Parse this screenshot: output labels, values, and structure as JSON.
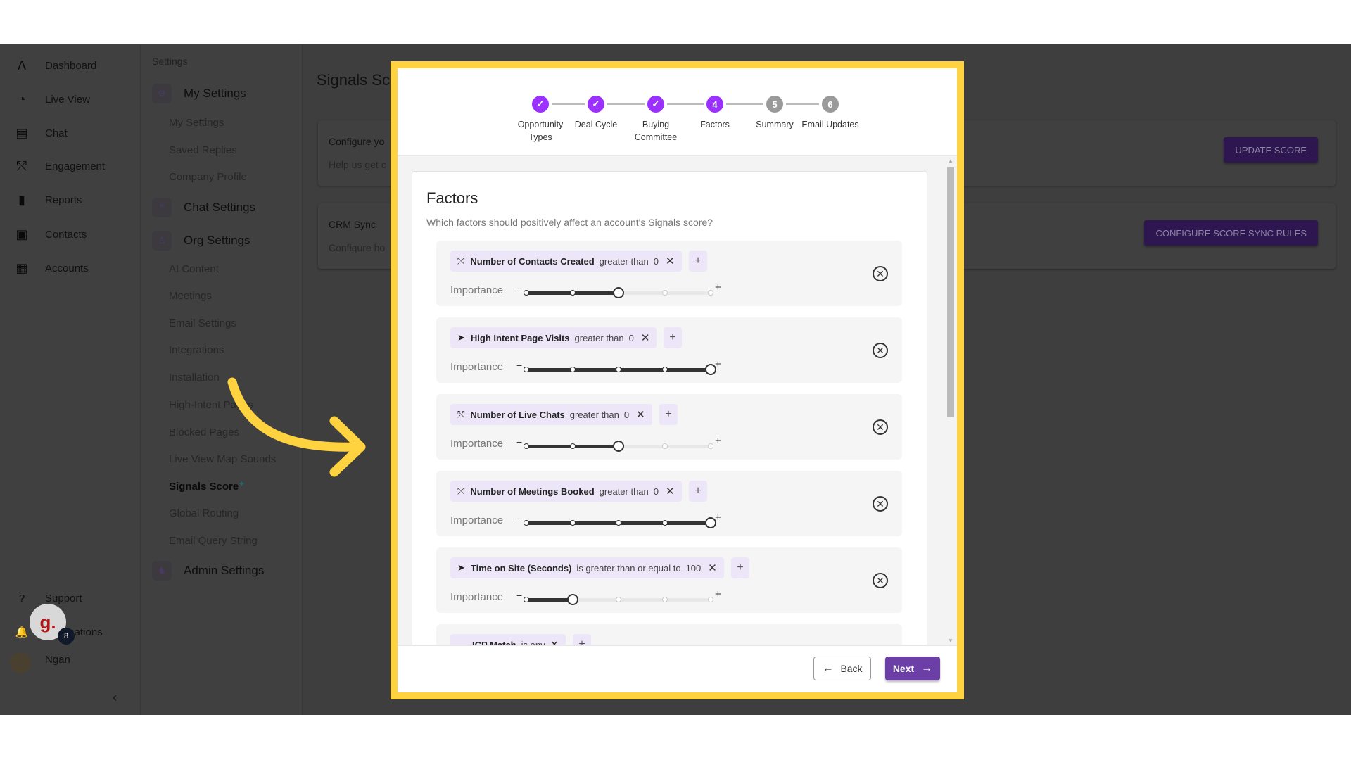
{
  "nav": {
    "items": [
      {
        "label": "Dashboard",
        "icon": "logo-icon"
      },
      {
        "label": "Live View",
        "icon": "live-view-icon"
      },
      {
        "label": "Chat",
        "icon": "chat-icon"
      },
      {
        "label": "Engagement",
        "icon": "engagement-icon"
      },
      {
        "label": "Reports",
        "icon": "reports-icon"
      },
      {
        "label": "Contacts",
        "icon": "contacts-icon"
      },
      {
        "label": "Accounts",
        "icon": "accounts-icon"
      }
    ],
    "support": "Support",
    "notifications": "Notifications",
    "user": "Ngan",
    "chat_bubble": "g.",
    "chat_badge": "8"
  },
  "settings": {
    "title": "Settings",
    "my_settings": "My Settings",
    "my_items": [
      "My Settings",
      "Saved Replies",
      "Company Profile"
    ],
    "chat_settings": "Chat Settings",
    "org_settings": "Org Settings",
    "org_items": [
      "AI Content",
      "Meetings",
      "Email Settings",
      "Integrations",
      "Installation",
      "High-Intent Pages",
      "Blocked Pages",
      "Live View Map Sounds",
      "Signals Score",
      "Global Routing",
      "Email Query String"
    ],
    "active": "Signals Score",
    "admin_settings": "Admin Settings"
  },
  "main": {
    "title": "Signals Sc",
    "cards": [
      {
        "title": "Configure yo",
        "desc": "Help us get c",
        "button": "UPDATE SCORE"
      },
      {
        "title": "CRM Sync",
        "desc": "Configure ho",
        "button": "CONFIGURE SCORE SYNC RULES"
      }
    ]
  },
  "modal": {
    "steps": [
      {
        "label": "Opportunity Types",
        "num": "1",
        "state": "done"
      },
      {
        "label": "Deal Cycle",
        "num": "2",
        "state": "done"
      },
      {
        "label": "Buying Committee",
        "num": "3",
        "state": "done"
      },
      {
        "label": "Factors",
        "num": "4",
        "state": "current"
      },
      {
        "label": "Summary",
        "num": "5",
        "state": "todo"
      },
      {
        "label": "Email Updates",
        "num": "6",
        "state": "todo"
      }
    ],
    "title": "Factors",
    "subtitle": "Which factors should positively affect an account's Signals score?",
    "importance_label": "Importance",
    "importance_max": 5,
    "factors": [
      {
        "icon": "engagement-icon",
        "name": "Number of Contacts Created",
        "operator": "greater than",
        "value": "0",
        "importance": 3
      },
      {
        "icon": "cursor-icon",
        "name": "High Intent Page Visits",
        "operator": "greater than",
        "value": "0",
        "importance": 5
      },
      {
        "icon": "engagement-icon",
        "name": "Number of Live Chats",
        "operator": "greater than",
        "value": "0",
        "importance": 3
      },
      {
        "icon": "engagement-icon",
        "name": "Number of Meetings Booked",
        "operator": "greater than",
        "value": "0",
        "importance": 5
      },
      {
        "icon": "cursor-icon",
        "name": "Time on Site (Seconds)",
        "operator": "is greater than or equal to",
        "value": "100",
        "importance": 2
      },
      {
        "icon": "icp-icon",
        "name": "ICP Match",
        "operator": "is any",
        "value": "",
        "importance": null
      }
    ],
    "back": "Back",
    "next": "Next"
  },
  "colors": {
    "accent": "#9b30ff",
    "highlight": "#ffd23f",
    "next_button": "#6b3fa6",
    "chip": "#ede6f8"
  }
}
